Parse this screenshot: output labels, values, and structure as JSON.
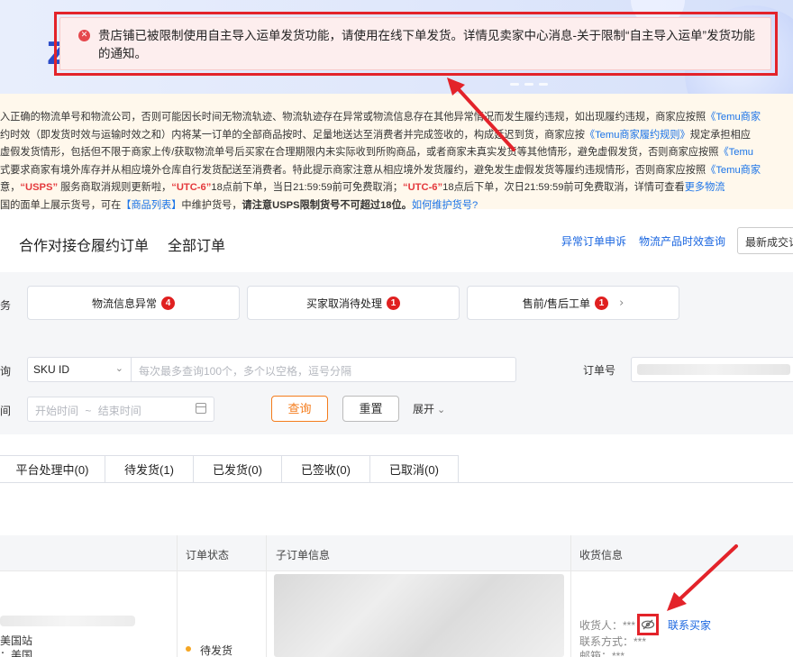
{
  "banner": {
    "glyph": "Z"
  },
  "toast": {
    "icon": "error-circle-icon",
    "message": "贵店铺已被限制使用自主导入运单发货功能，请使用在线下单发货。详情见卖家中心消息-关于限制“自主导入运单”发货功能的通知。"
  },
  "notice": {
    "line1": {
      "a": "入正确的物流单号和物流公司，否则可能因长时间无物流轨迹、物流轨迹存在异常或物流信息存在其他异常情况而发生履约违规，如出现履约违规，商家应按照",
      "b": "《Temu商家"
    },
    "line2": {
      "a": "约时效（即发货时效与运输时效之和）内将某一订单的全部商品按时、足量地送达至消费者并完成签收的，构成延迟到货，商家应按",
      "b": "《Temu商家履约规则》",
      "c": "规定承担相应"
    },
    "line3": {
      "a": "虚假发货情形，包括但不限于商家上传/获取物流单号后买家在合理期限内未实际收到所购商品，或者商家未真实发货等其他情形，避免虚假发货，否则商家应按照",
      "b": "《Temu"
    },
    "line4": {
      "a": "式要求商家有境外库存并从相应境外仓库自行发货配送至消费者。特此提示商家注意从相应境外发货履约，避免发生虚假发货等履约违规情形，否则商家应按照",
      "b": "《Temu商家"
    },
    "line5": {
      "a": "意，",
      "b": "“USPS”",
      "c": " 服务商取消规则更新啦，",
      "d": "“UTC-6”",
      "e": "18点前下单，当日21:59:59前可免费取消；",
      "f": "“UTC-6”",
      "g": "18点后下单，次日21:59:59前可免费取消，详情可查看",
      "h": "更多物流"
    },
    "line6": {
      "a": "国的面单上展示货号，可在",
      "b": "【商品列表】",
      "c": "中维护货号，",
      "d": "请注意USPS限制货号不可超过18位。",
      "e": "如何维护货号?"
    }
  },
  "header": {
    "tab1": "合作对接仓履约订单",
    "tab2": "全部订单",
    "link1": "异常订单申诉",
    "link2": "物流产品时效查询",
    "sort": "最新成交订"
  },
  "filters": {
    "row1_label": "务",
    "cards": [
      {
        "label": "物流信息异常",
        "count": "4"
      },
      {
        "label": "买家取消待处理",
        "count": "1"
      },
      {
        "label": "售前/售后工单",
        "count": "1"
      }
    ],
    "row2_label": "询",
    "select_value": "SKU ID",
    "query_placeholder": "每次最多查询100个，多个以空格，逗号分隔",
    "order_label": "订单号",
    "row3_label": "间",
    "date_start": "开始时间",
    "date_sep": "~",
    "date_end": "结束时间",
    "query_btn": "查询",
    "reset_btn": "重置",
    "expand": "展开"
  },
  "status_tabs": [
    "平台处理中(0)",
    "待发货(1)",
    "已发货(0)",
    "已签收(0)",
    "已取消(0)"
  ],
  "table": {
    "col_status": "订单状态",
    "col_sub": "子订单信息",
    "col_recv": "收货信息",
    "site": "美国站",
    "country": "：美国",
    "status": "待发货",
    "receiver": "收货人：***",
    "contact_way": "联系方式：***",
    "email": "邮箱：***",
    "contact_btn": "联系买家"
  },
  "colors": {
    "highlight_red": "#e3232a",
    "brand_orange": "#f47c1c",
    "link_blue": "#1a66e0"
  }
}
